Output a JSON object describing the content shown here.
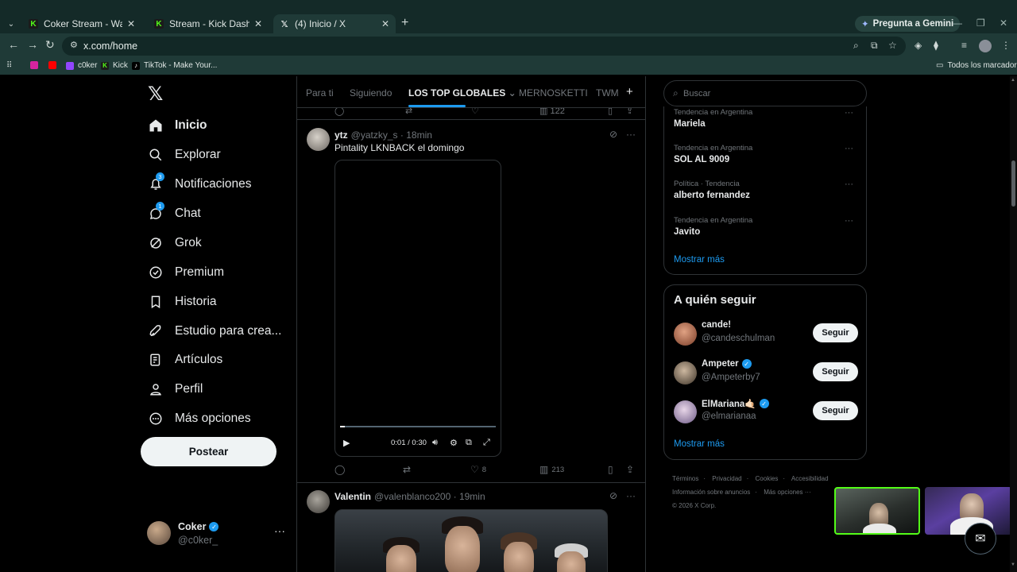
{
  "browser": {
    "tabs": [
      {
        "title": "Coker Stream - Watch Live on K",
        "favicon": "kick"
      },
      {
        "title": "Stream - Kick Dashboard",
        "favicon": "kick"
      },
      {
        "title": "(4) Inicio / X",
        "favicon": "x"
      }
    ],
    "new_tab": "+",
    "gemini": "Pregunta a Gemini",
    "url": "x.com/home",
    "bookmarks": [
      {
        "label": "",
        "icon": "instagram-icon"
      },
      {
        "label": "",
        "icon": "youtube-icon"
      },
      {
        "label": "c0ker",
        "icon": "twitch-icon"
      },
      {
        "label": "Kick",
        "icon": "kick-icon"
      },
      {
        "label": "TikTok - Make Your...",
        "icon": "tiktok-icon"
      }
    ],
    "all_bookmarks": "Todos los marcadores"
  },
  "nav": {
    "logo": "𝕏",
    "items": [
      {
        "label": "Inicio",
        "icon": "home-icon",
        "glyph": "⌂",
        "active": true
      },
      {
        "label": "Explorar",
        "icon": "search-icon",
        "glyph": "⌕"
      },
      {
        "label": "Notificaciones",
        "icon": "bell-icon",
        "glyph": "🔔︎",
        "badge": "3"
      },
      {
        "label": "Chat",
        "icon": "chat-icon",
        "glyph": "◯",
        "badge": "1"
      },
      {
        "label": "Grok",
        "icon": "grok-icon",
        "glyph": "⊘"
      },
      {
        "label": "Premium",
        "icon": "premium-icon",
        "glyph": "✓"
      },
      {
        "label": "Historia",
        "icon": "bookmark-icon",
        "glyph": "▯"
      },
      {
        "label": "Estudio para crea...",
        "icon": "rocket-icon",
        "glyph": "➶"
      },
      {
        "label": "Artículos",
        "icon": "article-icon",
        "glyph": "▤"
      },
      {
        "label": "Perfil",
        "icon": "profile-icon",
        "glyph": "♙"
      },
      {
        "label": "Más opciones",
        "icon": "more-options-icon",
        "glyph": "⋯"
      }
    ],
    "post_button": "Postear",
    "account": {
      "name": "Coker",
      "handle": "@c0ker_",
      "more": "···"
    }
  },
  "feed": {
    "tabs": [
      "Para ti",
      "Siguiendo",
      "LOS TOP GLOBALES",
      "MERNOSKETTI",
      "TWM"
    ],
    "active_tab": "LOS TOP GLOBALES",
    "prev_views": "122",
    "tweets": [
      {
        "name": "ytz",
        "handle": "@yatzky_s",
        "time": "18min",
        "text": "Pintality LKNBACK el domingo",
        "video": {
          "time": "0:01 / 0:30",
          "progress": 0.03
        },
        "likes": "8",
        "views": "213"
      },
      {
        "name": "Valentin",
        "handle": "@valenblanco200",
        "time": "19min"
      }
    ]
  },
  "search": {
    "placeholder": "Buscar"
  },
  "trends": [
    {
      "context": "Tendencia en Argentina",
      "name": "Mariela"
    },
    {
      "context": "Tendencia en Argentina",
      "name": "SOL AL 9009"
    },
    {
      "context": "Política · Tendencia",
      "name": "alberto fernandez"
    },
    {
      "context": "Tendencia en Argentina",
      "name": "Javito"
    }
  ],
  "trends_show_more": "Mostrar más",
  "who_to_follow": {
    "title": "A quién seguir",
    "users": [
      {
        "name": "cande!",
        "handle": "@candeschulman",
        "verified": false,
        "button": "Seguir",
        "color": "#b5654a"
      },
      {
        "name": "Ampeter",
        "handle": "@Ampeterby7",
        "verified": true,
        "button": "Seguir",
        "color": "#7a6a58"
      },
      {
        "name": "ElMariana🤙🏻",
        "handle": "@elmarianaa",
        "verified": true,
        "button": "Seguir",
        "color": "#9a8aa8"
      }
    ],
    "show_more": "Mostrar más"
  },
  "footer": {
    "links": [
      "Términos",
      "Privacidad",
      "Cookies",
      "Accesibilidad",
      "Información sobre anuncios",
      "Más opciones ···"
    ],
    "copyright": "© 2026 X Corp."
  }
}
